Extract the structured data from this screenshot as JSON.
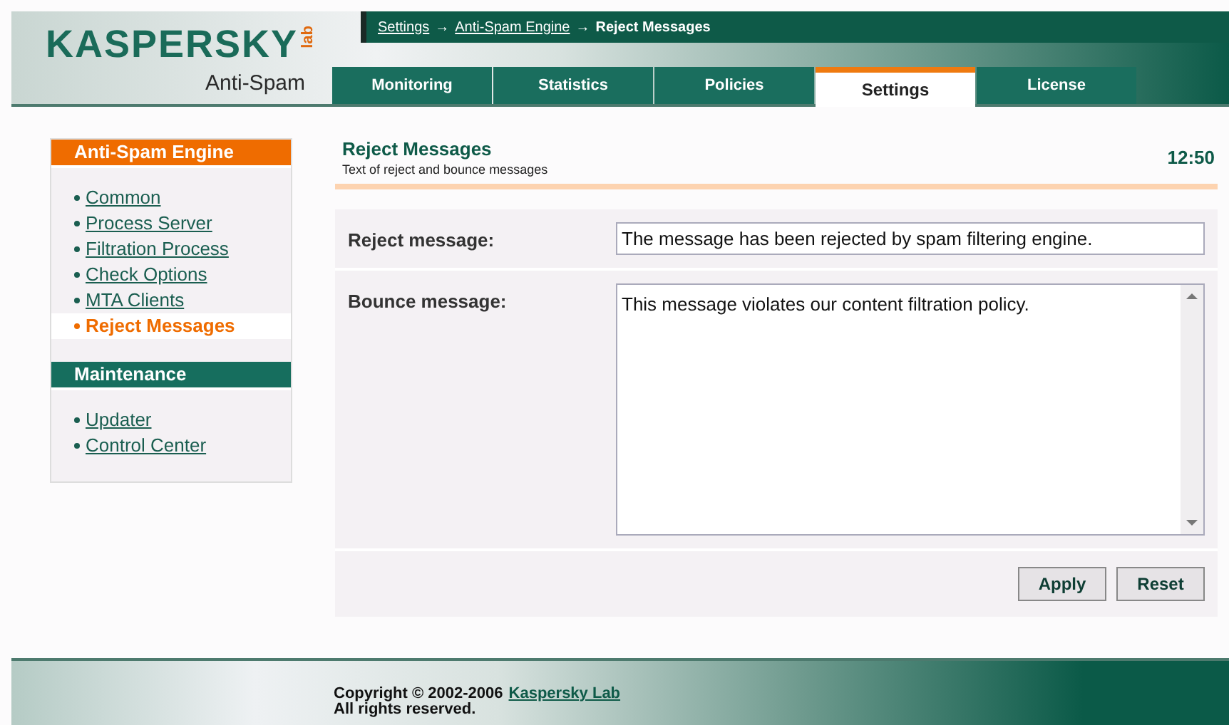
{
  "logo": {
    "brand": "KASPERSKY",
    "lab": "lab",
    "product": "Anti-Spam"
  },
  "breadcrumb": [
    {
      "label": "Settings",
      "kind": "link"
    },
    {
      "label": "→",
      "kind": "sep"
    },
    {
      "label": "Anti-Spam Engine",
      "kind": "link"
    },
    {
      "label": "→",
      "kind": "sep"
    },
    {
      "label": "Reject Messages",
      "kind": "current"
    }
  ],
  "tabs": [
    {
      "label": "Monitoring",
      "selected": false
    },
    {
      "label": "Statistics",
      "selected": false
    },
    {
      "label": "Policies",
      "selected": false
    },
    {
      "label": "Settings",
      "selected": true
    },
    {
      "label": "License",
      "selected": false
    }
  ],
  "sidebar": [
    {
      "title": "Anti-Spam Engine",
      "color": "#ef6c00",
      "items": [
        {
          "label": "Common",
          "selected": false
        },
        {
          "label": "Process Server",
          "selected": false
        },
        {
          "label": "Filtration Process",
          "selected": false
        },
        {
          "label": "Check Options",
          "selected": false
        },
        {
          "label": "MTA Clients",
          "selected": false
        },
        {
          "label": "Reject Messages",
          "selected": true
        }
      ]
    },
    {
      "title": "Maintenance",
      "color": "#166e5e",
      "items": [
        {
          "label": "Updater",
          "selected": false
        },
        {
          "label": "Control Center",
          "selected": false
        }
      ]
    }
  ],
  "page": {
    "title": "Reject Messages",
    "subtitle": "Text of reject and bounce messages",
    "time": "12:50"
  },
  "fields": [
    {
      "label": "Reject message:",
      "kind": "line",
      "value": "The message has been rejected by spam filtering engine."
    },
    {
      "label": "Bounce message:",
      "kind": "area",
      "value": "This message violates our content filtration policy."
    }
  ],
  "buttons": [
    "Apply",
    "Reset"
  ],
  "footer": {
    "copyright": "Copyright © 2002-2006",
    "link": "Kaspersky Lab",
    "rights": "All rights reserved."
  }
}
